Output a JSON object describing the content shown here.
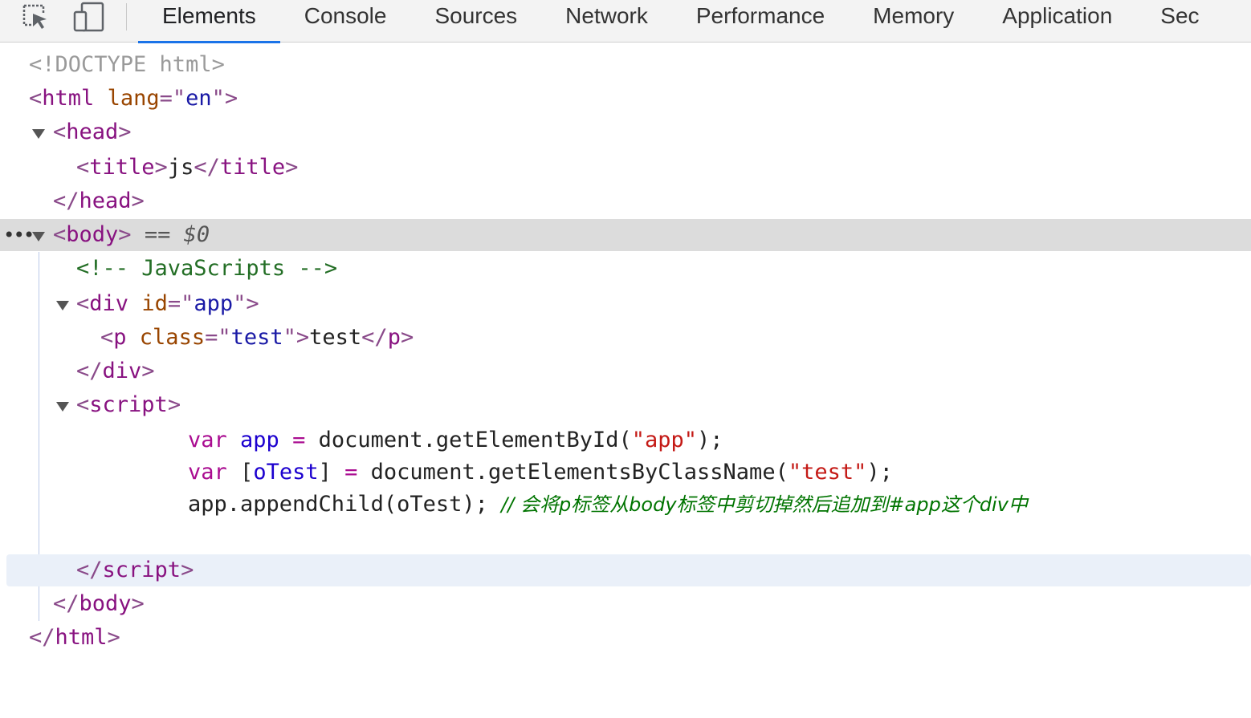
{
  "tabs": [
    "Elements",
    "Console",
    "Sources",
    "Network",
    "Performance",
    "Memory",
    "Application",
    "Sec"
  ],
  "active_tab": "Elements",
  "icons": {
    "inspect": "inspect-element-icon",
    "device": "device-toolbar-icon",
    "expand": "triangle-down-icon",
    "more": "more-dots-icon"
  },
  "dom": {
    "doctype": "<!DOCTYPE html>",
    "html_tag": "html",
    "lang_attr": "lang",
    "lang_value": "en",
    "head_tag": "head",
    "title_tag": "title",
    "title_text": "js",
    "body_tag": "body",
    "body_marker": "== $0",
    "comment": "<!-- JavaScripts -->",
    "div_tag": "div",
    "div_attr": "id",
    "div_value": "app",
    "p_tag": "p",
    "p_attr": "class",
    "p_value": "test",
    "p_text": "test",
    "script_tag": "script"
  },
  "script": {
    "line1": {
      "kw": "var",
      "ident": "app",
      "eq": "=",
      "call": "document.getElementById(",
      "arg": "\"app\"",
      "end": ");"
    },
    "line2": {
      "kw": "var",
      "ident_open": "[",
      "ident": "oTest",
      "ident_close": "]",
      "eq": "=",
      "call": "document.getElementsByClassName(",
      "arg": "\"test\"",
      "end": ");"
    },
    "line3": {
      "code": "app.appendChild(oTest);",
      "comment": "// 会将p标签从body标签中剪切掉然后追加到#app这个div中"
    }
  },
  "colors": {
    "active_tab_underline": "#1a73e8",
    "selected_row": "#dcdcdc",
    "hover_row": "#eaf0f9",
    "tag": "#881280",
    "attr": "#994500",
    "value": "#1a1aa6",
    "comment": "#236e25"
  }
}
